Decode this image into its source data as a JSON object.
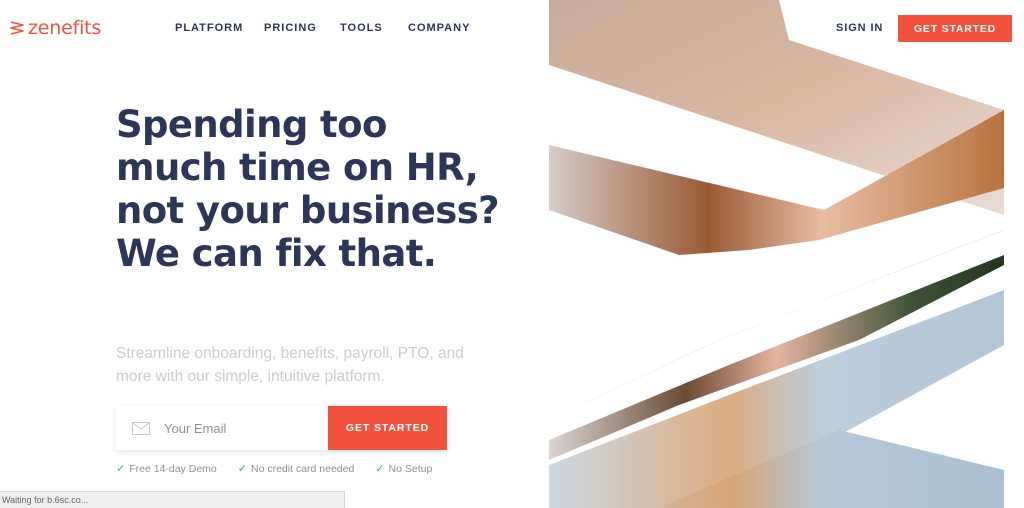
{
  "brand": {
    "name": "zenefits",
    "accent": "#f2523c",
    "ink": "#2b3658"
  },
  "nav": {
    "items": [
      {
        "label": "PLATFORM"
      },
      {
        "label": "PRICING"
      },
      {
        "label": "TOOLS"
      },
      {
        "label": "COMPANY"
      }
    ]
  },
  "header": {
    "sign_in": "SIGN IN",
    "cta": "GET STARTED"
  },
  "hero": {
    "headline_lines": [
      "Spending too",
      "much time on HR,",
      "not your business?"
    ],
    "headline_bold": "We can fix that.",
    "subtext": "Streamline onboarding, benefits, payroll, PTO, and more with our simple, intuitive platform.",
    "email_placeholder": "Your Email",
    "email_value": "",
    "cta": "GET STARTED",
    "perks": [
      "Free 14-day Demo",
      "No credit card needed",
      "No Setup"
    ],
    "image_icon": "hero-photo-woman-smiling"
  },
  "status_bar": {
    "text": "Waiting for b.6sc.co..."
  },
  "icons": {
    "logo": "zenefits-logo-icon",
    "mail": "mail-icon",
    "check": "check-icon"
  }
}
